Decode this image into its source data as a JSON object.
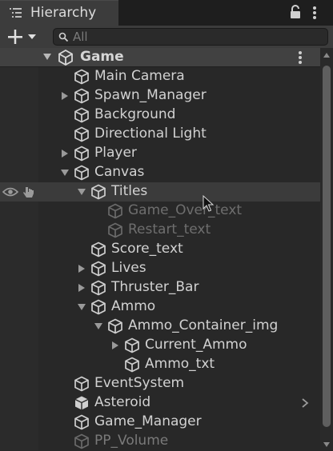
{
  "window": {
    "tab_label": "Hierarchy",
    "tab_icon": "hierarchy-list-icon",
    "lock_icon": "lock-icon",
    "menu_icon": "kebab-menu-icon"
  },
  "toolbar": {
    "add_icon": "plus-icon",
    "dropdown_icon": "chevron-down-icon",
    "search": {
      "placeholder": "All",
      "value": ""
    }
  },
  "scene": {
    "name": "Game",
    "expanded": true,
    "icon": "unity-logo-icon"
  },
  "colors": {
    "background": "#282828",
    "header": "#414141",
    "selected_row": "#3b3b3b",
    "text": "#d2d2d2",
    "disabled_text": "#6e6e6e"
  },
  "tree": {
    "items": [
      {
        "label": "Main Camera",
        "depth": 0,
        "fold": "none",
        "state": "normal",
        "icon": "cube-icon"
      },
      {
        "label": "Spawn_Manager",
        "depth": 0,
        "fold": "collapsed",
        "state": "normal",
        "icon": "cube-icon"
      },
      {
        "label": "Background",
        "depth": 0,
        "fold": "none",
        "state": "normal",
        "icon": "cube-icon"
      },
      {
        "label": "Directional Light",
        "depth": 0,
        "fold": "none",
        "state": "normal",
        "icon": "cube-icon"
      },
      {
        "label": "Player",
        "depth": 0,
        "fold": "collapsed",
        "state": "normal",
        "icon": "cube-icon"
      },
      {
        "label": "Canvas",
        "depth": 0,
        "fold": "expanded",
        "state": "normal",
        "icon": "cube-icon"
      },
      {
        "label": "Titles",
        "depth": 1,
        "fold": "expanded",
        "state": "hover",
        "icon": "cube-icon"
      },
      {
        "label": "Game_Over_text",
        "depth": 2,
        "fold": "none",
        "state": "disabled",
        "icon": "cube-icon"
      },
      {
        "label": "Restart_text",
        "depth": 2,
        "fold": "none",
        "state": "disabled",
        "icon": "cube-icon"
      },
      {
        "label": "Score_text",
        "depth": 1,
        "fold": "none",
        "state": "normal",
        "icon": "cube-icon"
      },
      {
        "label": "Lives",
        "depth": 1,
        "fold": "collapsed",
        "state": "normal",
        "icon": "cube-icon"
      },
      {
        "label": "Thruster_Bar",
        "depth": 1,
        "fold": "collapsed",
        "state": "normal",
        "icon": "cube-icon"
      },
      {
        "label": "Ammo",
        "depth": 1,
        "fold": "expanded",
        "state": "normal",
        "icon": "cube-icon"
      },
      {
        "label": "Ammo_Container_img",
        "depth": 2,
        "fold": "expanded",
        "state": "normal",
        "icon": "cube-icon"
      },
      {
        "label": "Current_Ammo",
        "depth": 3,
        "fold": "collapsed",
        "state": "normal",
        "icon": "cube-icon"
      },
      {
        "label": "Ammo_txt",
        "depth": 3,
        "fold": "none",
        "state": "normal",
        "icon": "cube-icon"
      },
      {
        "label": "EventSystem",
        "depth": 0,
        "fold": "none",
        "state": "normal",
        "icon": "cube-icon"
      },
      {
        "label": "Asteroid",
        "depth": 0,
        "fold": "none",
        "state": "prefab",
        "icon": "prefab-cube-icon"
      },
      {
        "label": "Game_Manager",
        "depth": 0,
        "fold": "none",
        "state": "normal",
        "icon": "cube-icon"
      },
      {
        "label": "PP_Volume",
        "depth": 0,
        "fold": "none",
        "state": "inactive",
        "icon": "cube-icon"
      }
    ]
  }
}
